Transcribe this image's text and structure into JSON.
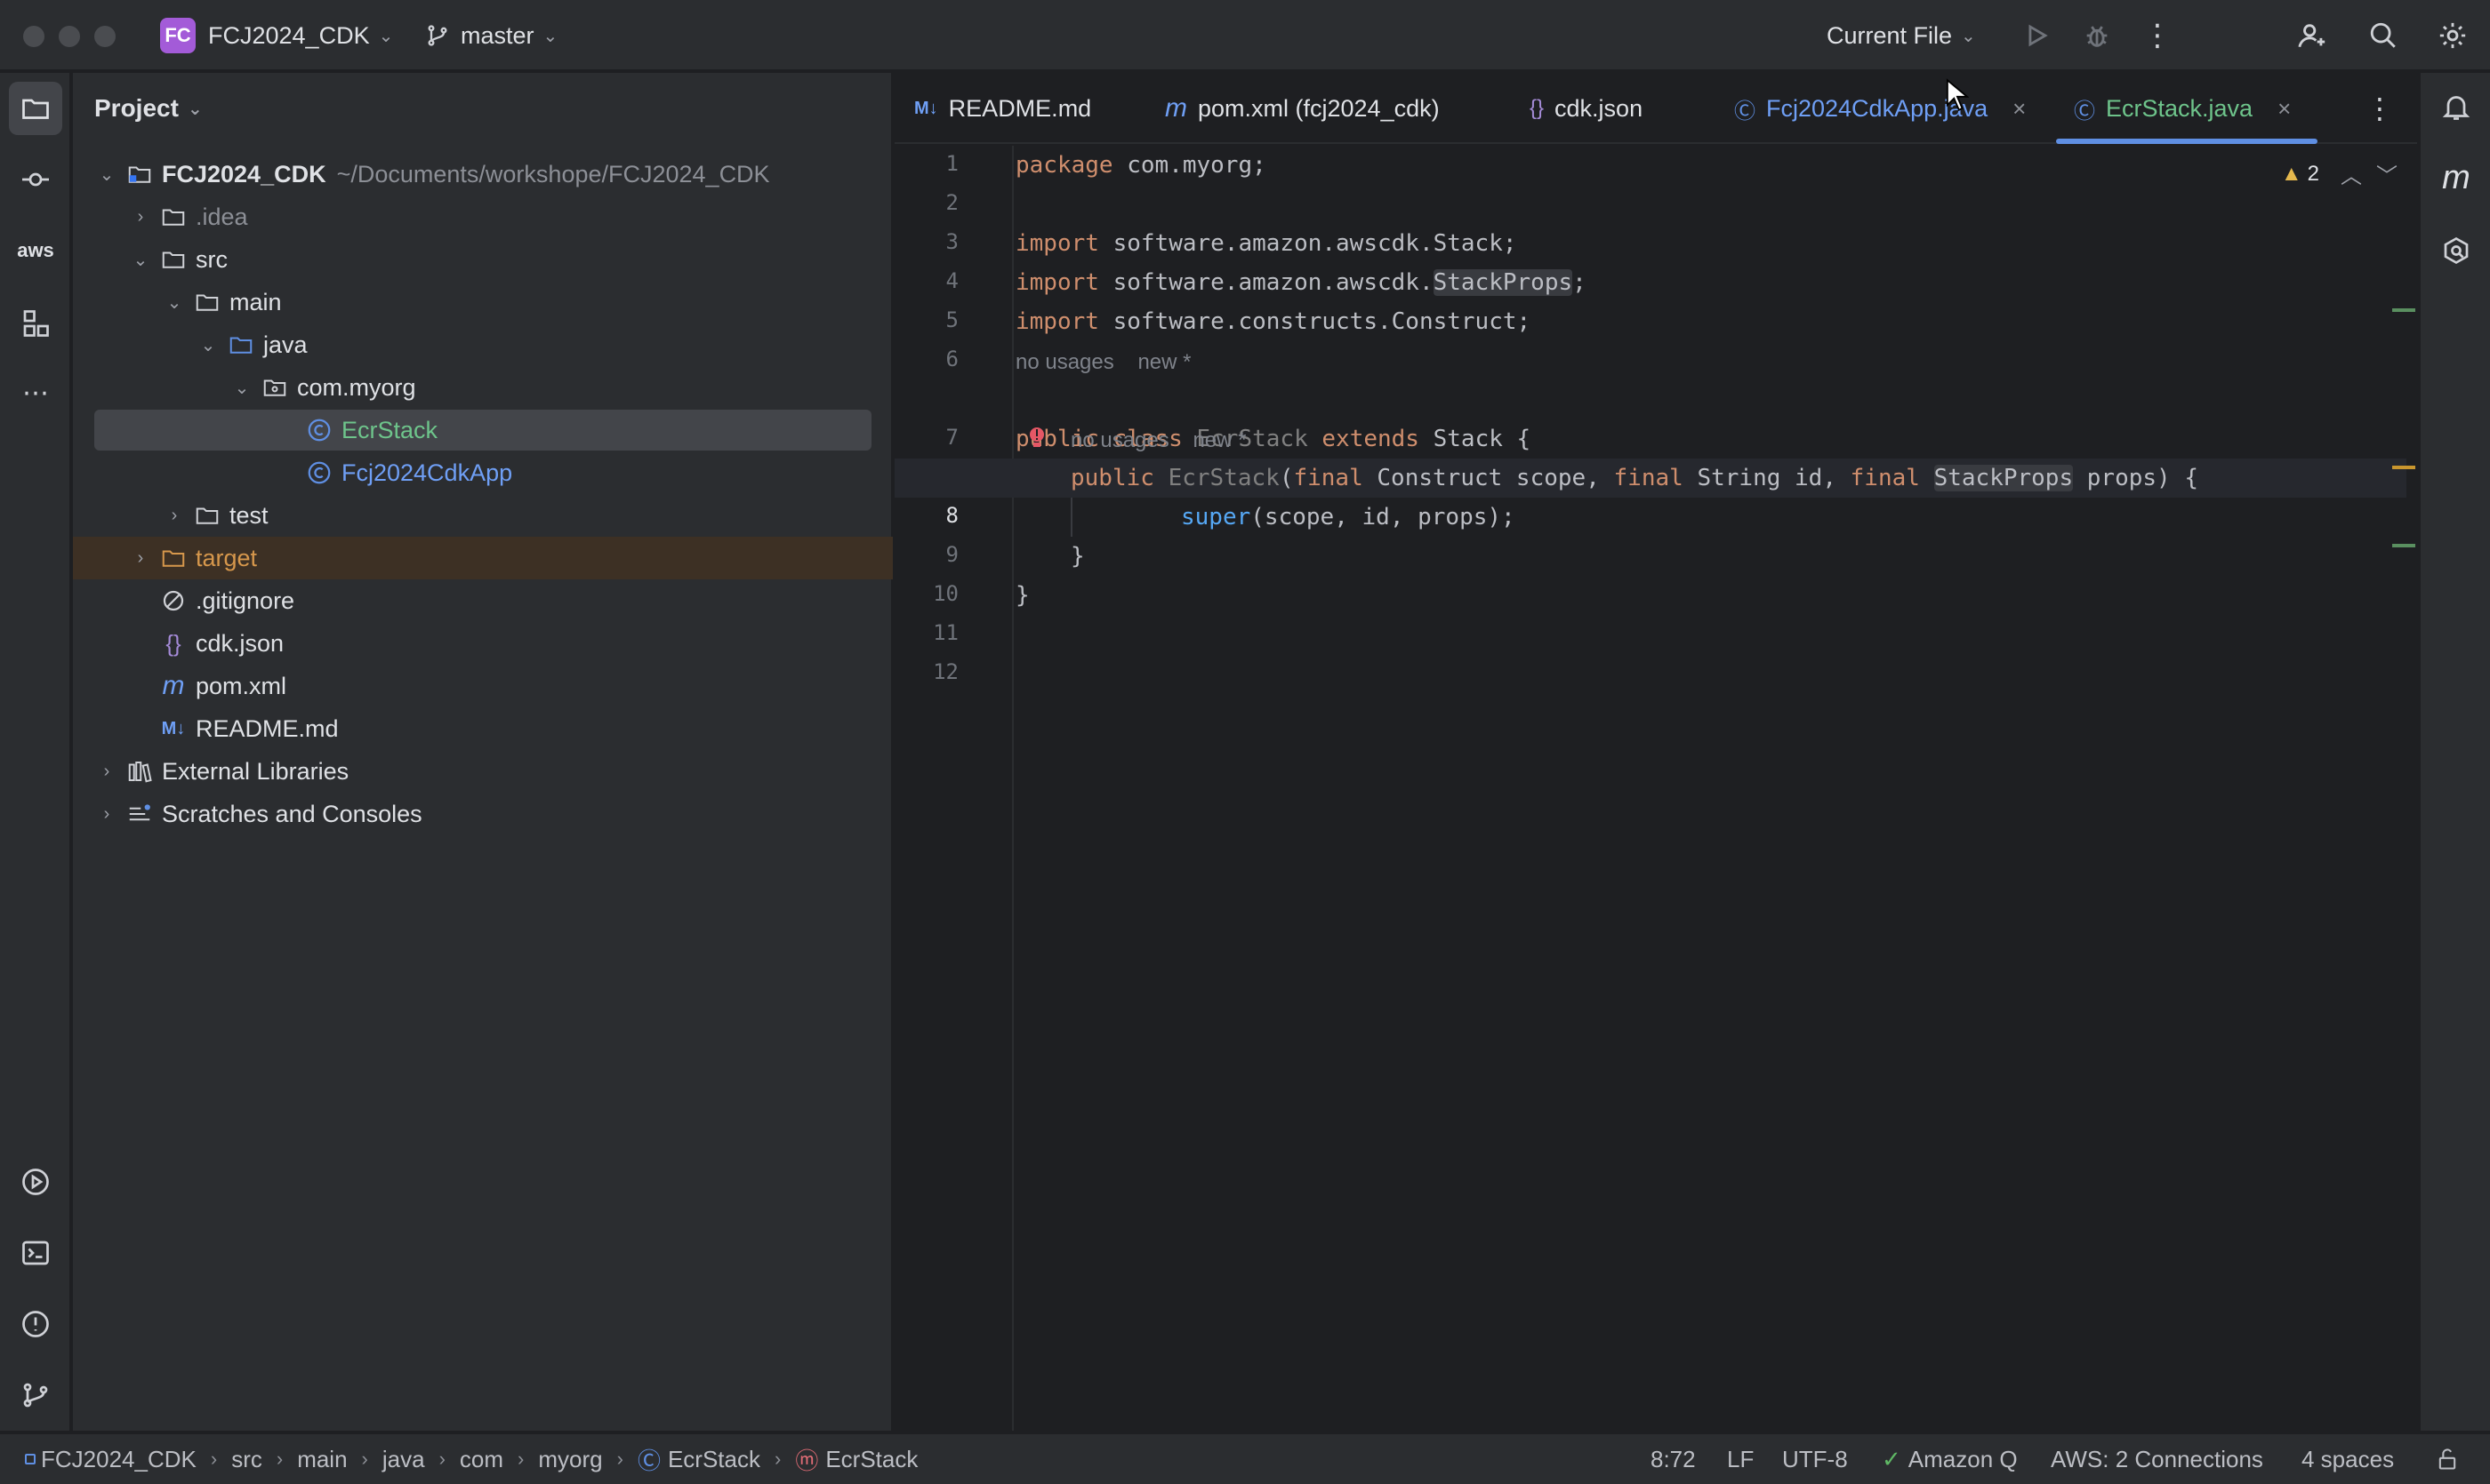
{
  "titlebar": {
    "project_badge": "FC",
    "project_name": "FCJ2024_CDK",
    "branch": "master",
    "run_config": "Current File"
  },
  "project_panel": {
    "title": "Project",
    "tree": [
      {
        "label": "FCJ2024_CDK",
        "path": "~/Documents/workshope/FCJ2024_CDK"
      },
      {
        "label": ".idea"
      },
      {
        "label": "src"
      },
      {
        "label": "main"
      },
      {
        "label": "java"
      },
      {
        "label": "com.myorg"
      },
      {
        "label": "EcrStack"
      },
      {
        "label": "Fcj2024CdkApp"
      },
      {
        "label": "test"
      },
      {
        "label": "target"
      },
      {
        "label": ".gitignore"
      },
      {
        "label": "cdk.json"
      },
      {
        "label": "pom.xml"
      },
      {
        "label": "README.md"
      },
      {
        "label": "External Libraries"
      },
      {
        "label": "Scratches and Consoles"
      }
    ]
  },
  "tabs": [
    {
      "label": "README.md",
      "icon": "M↓"
    },
    {
      "label": "pom.xml (fcj2024_cdk)",
      "icon": "m"
    },
    {
      "label": "cdk.json",
      "icon": "{}"
    },
    {
      "label": "Fcj2024CdkApp.java",
      "icon": "C"
    },
    {
      "label": "EcrStack.java",
      "icon": "C"
    }
  ],
  "editor": {
    "line_numbers": [
      "1",
      "2",
      "3",
      "4",
      "5",
      "6",
      "7",
      "8",
      "9",
      "10",
      "11",
      "12"
    ],
    "inspection_count": "2",
    "hints": {
      "class_usages": "no usages",
      "class_new": "new *",
      "ctor_usages": "no usages",
      "ctor_new": "new *"
    },
    "code": {
      "l1_kw": "package",
      "l1_rest": " com.myorg;",
      "l3_kw": "import",
      "l3_rest": " software.amazon.awscdk.Stack;",
      "l4_kw": "import",
      "l4_a": " software.amazon.awscdk.",
      "l4_b": "StackProps",
      "l4_c": ";",
      "l5_kw": "import",
      "l5_rest": " software.constructs.Construct;",
      "l7_a": "public class",
      "l7_b": " EcrStack",
      "l7_c": " extends",
      "l7_d": " Stack {",
      "l8_a": "public",
      "l8_b": " EcrStack",
      "l8_c": "(",
      "l8_d": "final",
      "l8_e": " Construct scope, ",
      "l8_f": "final",
      "l8_g": " String id, ",
      "l8_h": "final",
      "l8_i": " ",
      "l8_j": "StackProps",
      "l8_k": " props) {",
      "l9_a": "super",
      "l9_b": "(scope, id, props);",
      "l10": "}",
      "l11": "}"
    }
  },
  "statusbar": {
    "breadcrumbs": [
      "FCJ2024_CDK",
      "src",
      "main",
      "java",
      "com",
      "myorg",
      "EcrStack",
      "EcrStack"
    ],
    "caret": "8:72",
    "line_sep": "LF",
    "encoding": "UTF-8",
    "amazon_q": "Amazon Q",
    "aws": "AWS: 2 Connections",
    "indent": "4 spaces"
  },
  "colors": {
    "accent": "#5f8fe3",
    "keyword": "#cf8e6d",
    "method": "#56a8f5",
    "excluded_folder": "#d6974c",
    "modified_file": "#6ec48b"
  }
}
